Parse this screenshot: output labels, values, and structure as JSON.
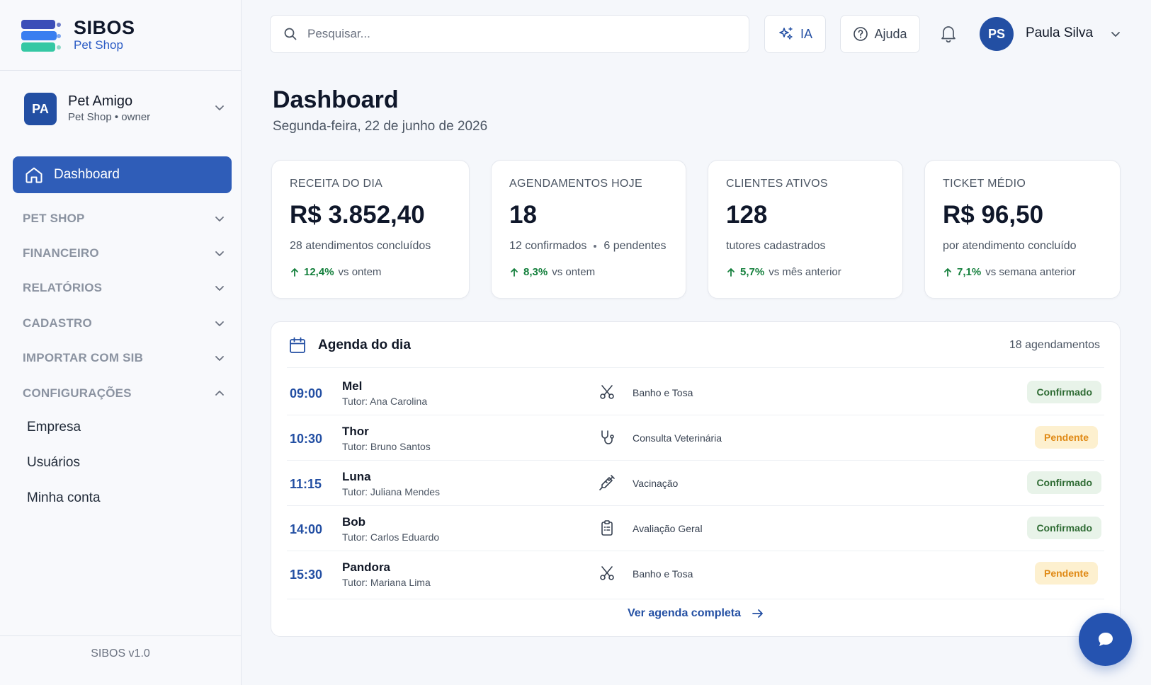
{
  "brand": {
    "name": "SIBOS",
    "subtitle": "Pet Shop"
  },
  "organization": {
    "initials": "PA",
    "name": "Pet Amigo",
    "role": "Pet Shop • owner"
  },
  "sidebar": {
    "active": {
      "label": "Dashboard",
      "icon": "home-icon"
    },
    "sections": [
      {
        "label": "PET SHOP",
        "expanded": false
      },
      {
        "label": "FINANCEIRO",
        "expanded": false
      },
      {
        "label": "RELATÓRIOS",
        "expanded": false
      },
      {
        "label": "CADASTRO",
        "expanded": false
      },
      {
        "label": "IMPORTAR COM SIB",
        "expanded": false
      },
      {
        "label": "CONFIGURAÇÕES",
        "expanded": true
      }
    ],
    "sub_items": [
      "Empresa",
      "Usuários",
      "Minha conta"
    ],
    "version": "SIBOS v1.0"
  },
  "topbar": {
    "search_placeholder": "Pesquisar...",
    "ai_label": "IA",
    "help_label": "Ajuda",
    "user_initials": "PS",
    "user_name": "Paula Silva"
  },
  "page": {
    "title": "Dashboard",
    "date": "Segunda-feira, 22 de junho de 2026"
  },
  "kpis": [
    {
      "label": "RECEITA DO DIA",
      "value": "R$ 3.852,40",
      "desc": "28 atendimentos concluídos",
      "trend_pct": "12,4%",
      "trend_text": "vs ontem"
    },
    {
      "label": "AGENDAMENTOS HOJE",
      "value": "18",
      "desc_a": "12 confirmados",
      "desc_b": "6 pendentes",
      "trend_pct": "8,3%",
      "trend_text": "vs ontem"
    },
    {
      "label": "CLIENTES ATIVOS",
      "value": "128",
      "desc": "tutores cadastrados",
      "trend_pct": "5,7%",
      "trend_text": "vs mês anterior"
    },
    {
      "label": "TICKET MÉDIO",
      "value": "R$ 96,50",
      "desc": "por atendimento concluído",
      "trend_pct": "7,1%",
      "trend_text": "vs semana anterior"
    }
  ],
  "agenda": {
    "title": "Agenda do dia",
    "count": "18 agendamentos",
    "rows": [
      {
        "time": "09:00",
        "pet": "Mel",
        "tutor": "Tutor: Ana Carolina",
        "service": "Banho e Tosa",
        "service_icon": "scissors-icon",
        "status": "Confirmado"
      },
      {
        "time": "10:30",
        "pet": "Thor",
        "tutor": "Tutor: Bruno Santos",
        "service": "Consulta Veterinária",
        "service_icon": "stethoscope-icon",
        "status": "Pendente"
      },
      {
        "time": "11:15",
        "pet": "Luna",
        "tutor": "Tutor: Juliana Mendes",
        "service": "Vacinação",
        "service_icon": "syringe-icon",
        "status": "Confirmado"
      },
      {
        "time": "14:00",
        "pet": "Bob",
        "tutor": "Tutor: Carlos Eduardo",
        "service": "Avaliação Geral",
        "service_icon": "clipboard-icon",
        "status": "Confirmado"
      },
      {
        "time": "15:30",
        "pet": "Pandora",
        "tutor": "Tutor: Mariana Lima",
        "service": "Banho e Tosa",
        "service_icon": "scissors-icon",
        "status": "Pendente"
      }
    ],
    "footer_link": "Ver agenda completa"
  },
  "colors": {
    "primary": "#2f5db8",
    "success": "#15803d",
    "warning": "#e08a16",
    "confirm_bg": "#e8f3e9",
    "pending_bg": "#fdf0cf"
  }
}
